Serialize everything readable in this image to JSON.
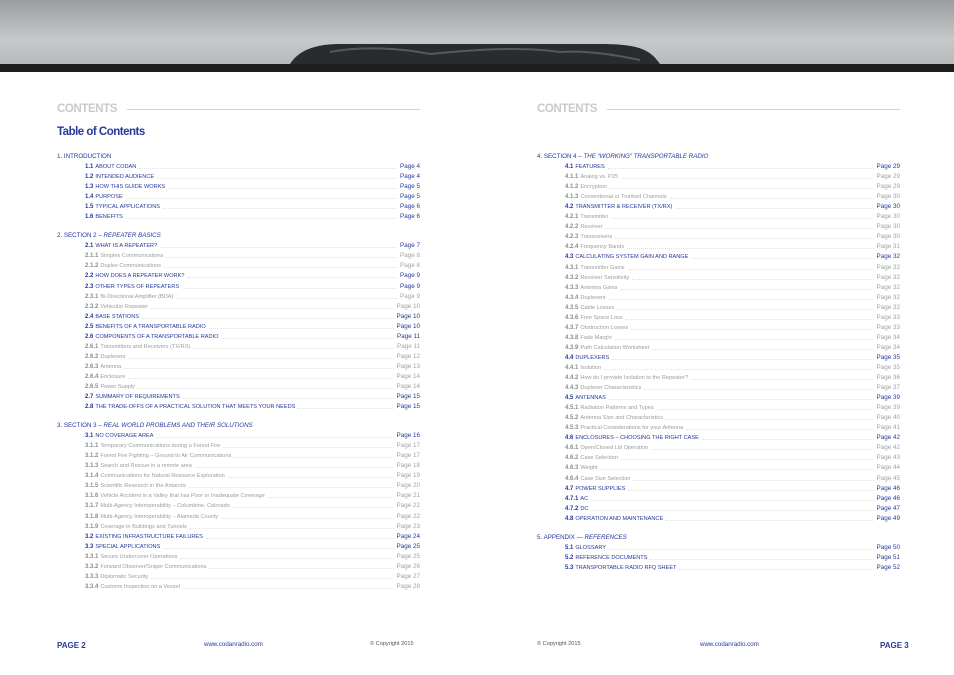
{
  "left": {
    "contents_label": "CONTENTS",
    "title": "Table of Contents",
    "sections": [
      {
        "number": "1.",
        "title": "INTRODUCTION",
        "subtitle": "",
        "entries": [
          {
            "level": 1,
            "num": "1.1",
            "title": "ABOUT CODAN",
            "page": "Page 4"
          },
          {
            "level": 1,
            "num": "1.2",
            "title": "INTENDED AUDIENCE",
            "page": "Page 4"
          },
          {
            "level": 1,
            "num": "1.3",
            "title": "HOW THIS GUIDE WORKS",
            "page": "Page 5"
          },
          {
            "level": 1,
            "num": "1.4",
            "title": "PURPOSE",
            "page": "Page 5"
          },
          {
            "level": 1,
            "num": "1.5",
            "title": "TYPICAL APPLICATIONS",
            "page": "Page 6"
          },
          {
            "level": 1,
            "num": "1.6",
            "title": "BENEFITS",
            "page": "Page 6"
          }
        ]
      },
      {
        "number": "2.",
        "title": "SECTION 2 –",
        "subtitle": "REPEATER BASICS",
        "entries": [
          {
            "level": 1,
            "num": "2.1",
            "title": "WHAT IS A REPEATER?",
            "page": "Page 7"
          },
          {
            "level": 2,
            "num": "2.1.1",
            "title": "Simplex Communications",
            "page": "Page 8"
          },
          {
            "level": 2,
            "num": "2.1.2",
            "title": "Duplex Communications",
            "page": "Page 8"
          },
          {
            "level": 1,
            "num": "2.2",
            "title": "HOW DOES A REPEATER WORK?",
            "page": "Page 9"
          },
          {
            "level": 1,
            "num": "2.3",
            "title": "OTHER TYPES OF REPEATERS",
            "page": "Page 9"
          },
          {
            "level": 2,
            "num": "2.3.1",
            "title": "Bi-Directional Amplifier (BDA)",
            "page": "Page 9"
          },
          {
            "level": 2,
            "num": "2.3.2",
            "title": "Vehicular Repeater",
            "page": "Page 10"
          },
          {
            "level": 1,
            "num": "2.4",
            "title": "BASE STATIONS",
            "page": "Page 10"
          },
          {
            "level": 1,
            "num": "2.5",
            "title": "BENEFITS OF A TRANSPORTABLE RADIO",
            "page": "Page 10"
          },
          {
            "level": 1,
            "num": "2.6",
            "title": "COMPONENTS OF A TRANSPORTABLE RADIO",
            "page": "Page 11"
          },
          {
            "level": 2,
            "num": "2.6.1",
            "title": "Transmitters and Receivers (TX/RX)",
            "page": "Page 11"
          },
          {
            "level": 2,
            "num": "2.6.2",
            "title": "Duplexers",
            "page": "Page 12"
          },
          {
            "level": 2,
            "num": "2.6.3",
            "title": "Antenna",
            "page": "Page 13"
          },
          {
            "level": 2,
            "num": "2.6.4",
            "title": "Enclosure",
            "page": "Page 14"
          },
          {
            "level": 2,
            "num": "2.6.5",
            "title": "Power Supply",
            "page": "Page 14"
          },
          {
            "level": 1,
            "num": "2.7",
            "title": "SUMMARY OF REQUIREMENTS",
            "page": "Page 15"
          },
          {
            "level": 1,
            "num": "2.8",
            "title": "THE TRADE-OFFS OF A PRACTICAL SOLUTION THAT MEETS YOUR NEEDS",
            "page": "Page 15"
          }
        ]
      },
      {
        "number": "3.",
        "title": "SECTION 3 –",
        "subtitle": "REAL WORLD PROBLEMS AND THEIR SOLUTIONS",
        "entries": [
          {
            "level": 1,
            "num": "3.1",
            "title": "NO COVERAGE AREA",
            "page": "Page 16"
          },
          {
            "level": 2,
            "num": "3.1.1",
            "title": "Temporary Communications during a Forest Fire",
            "page": "Page 17"
          },
          {
            "level": 2,
            "num": "3.1.2",
            "title": "Forest Fire Fighting – Ground to Air Communications",
            "page": "Page 17"
          },
          {
            "level": 2,
            "num": "3.1.3",
            "title": "Search and Rescue in a remote area",
            "page": "Page 18"
          },
          {
            "level": 2,
            "num": "3.1.4",
            "title": "Communications for Natural Resource Exploration",
            "page": "Page 19"
          },
          {
            "level": 2,
            "num": "3.1.5",
            "title": "Scientific Research in the Antarctic",
            "page": "Page 20"
          },
          {
            "level": 2,
            "num": "3.1.6",
            "title": "Vehicle Accident in a Valley that has Poor or Inadequate Coverage",
            "page": "Page 21"
          },
          {
            "level": 2,
            "num": "3.1.7",
            "title": "Multi-Agency Interoperability – Columbine, Colorado",
            "page": "Page 22"
          },
          {
            "level": 2,
            "num": "3.1.8",
            "title": "Multi-Agency Interoperability – Alameda County",
            "page": "Page 22"
          },
          {
            "level": 2,
            "num": "3.1.9",
            "title": "Coverage in Buildings and Tunnels",
            "page": "Page 23"
          },
          {
            "level": 1,
            "num": "3.2",
            "title": "EXISTING INFRASTRUCTURE FAILURES",
            "page": "Page 24"
          },
          {
            "level": 1,
            "num": "3.3",
            "title": "SPECIAL APPLICATIONS",
            "page": "Page 25"
          },
          {
            "level": 2,
            "num": "3.3.1",
            "title": "Secure Undercover Operations",
            "page": "Page 25"
          },
          {
            "level": 2,
            "num": "3.3.2",
            "title": "Forward Observer/Sniper Communications",
            "page": "Page 26"
          },
          {
            "level": 2,
            "num": "3.3.3",
            "title": "Diplomatic Security",
            "page": "Page 27"
          },
          {
            "level": 2,
            "num": "3.3.4",
            "title": "Customs Inspection on a Vessel",
            "page": "Page 28"
          }
        ]
      }
    ],
    "footer": {
      "page_label": "PAGE 2",
      "url": "www.codanradio.com",
      "copyright": "© Copyright 2015"
    }
  },
  "right": {
    "contents_label": "CONTENTS",
    "sections": [
      {
        "number": "4.",
        "title": "SECTION 4 –",
        "subtitle": "THE “WORKING” TRANSPORTABLE RADIO",
        "entries": [
          {
            "level": 1,
            "num": "4.1",
            "title": "FEATURES",
            "page": "Page 29"
          },
          {
            "level": 2,
            "num": "4.1.1",
            "title": "Analog vs. P25",
            "page": "Page 29"
          },
          {
            "level": 2,
            "num": "4.1.2",
            "title": "Encryption",
            "page": "Page 29"
          },
          {
            "level": 2,
            "num": "4.1.3",
            "title": "Conventional or Trunked Channels",
            "page": "Page 30"
          },
          {
            "level": 1,
            "num": "4.2",
            "title": "TRANSMITTER & RECEIVER (TX/RX)",
            "page": "Page 30"
          },
          {
            "level": 2,
            "num": "4.2.1",
            "title": "Transmitter",
            "page": "Page 30"
          },
          {
            "level": 2,
            "num": "4.2.2",
            "title": "Receiver",
            "page": "Page 30"
          },
          {
            "level": 2,
            "num": "4.2.3",
            "title": "Transceivers",
            "page": "Page 30"
          },
          {
            "level": 2,
            "num": "4.2.4",
            "title": "Frequency Bands",
            "page": "Page 31"
          },
          {
            "level": 1,
            "num": "4.3",
            "title": "CALCULATING SYSTEM GAIN AND RANGE",
            "page": "Page 32"
          },
          {
            "level": 2,
            "num": "4.3.1",
            "title": "Transmitter Gains",
            "page": "Page 32"
          },
          {
            "level": 2,
            "num": "4.3.2",
            "title": "Receiver Sensitivity",
            "page": "Page 32"
          },
          {
            "level": 2,
            "num": "4.3.3",
            "title": "Antenna Gains",
            "page": "Page 32"
          },
          {
            "level": 2,
            "num": "4.3.4",
            "title": "Duplexers",
            "page": "Page 32"
          },
          {
            "level": 2,
            "num": "4.3.5",
            "title": "Cable Losses",
            "page": "Page 32"
          },
          {
            "level": 2,
            "num": "4.3.6",
            "title": "Free Space Loss",
            "page": "Page 33"
          },
          {
            "level": 2,
            "num": "4.3.7",
            "title": "Obstruction Losses",
            "page": "Page 33"
          },
          {
            "level": 2,
            "num": "4.3.8",
            "title": "Fade Margin",
            "page": "Page 34"
          },
          {
            "level": 2,
            "num": "4.3.9",
            "title": "Path Calculation Worksheet",
            "page": "Page 34"
          },
          {
            "level": 1,
            "num": "4.4",
            "title": "DUPLEXERS",
            "page": "Page 35"
          },
          {
            "level": 2,
            "num": "4.4.1",
            "title": "Isolation",
            "page": "Page 35"
          },
          {
            "level": 2,
            "num": "4.4.2",
            "title": "How do I provide Isolation to the Repeater?",
            "page": "Page 36"
          },
          {
            "level": 2,
            "num": "4.4.3",
            "title": "Duplexer Characteristics",
            "page": "Page 37"
          },
          {
            "level": 1,
            "num": "4.5",
            "title": "ANTENNAS",
            "page": "Page 39"
          },
          {
            "level": 2,
            "num": "4.5.1",
            "title": "Radiation Patterns and Types",
            "page": "Page 39"
          },
          {
            "level": 2,
            "num": "4.5.2",
            "title": "Antenna Size and Characteristics",
            "page": "Page 40"
          },
          {
            "level": 2,
            "num": "4.5.3",
            "title": "Practical Considerations for your Antenna",
            "page": "Page 41"
          },
          {
            "level": 1,
            "num": "4.6",
            "title": "ENCLOSURES – CHOOSING THE RIGHT CASE",
            "page": "Page 42"
          },
          {
            "level": 2,
            "num": "4.6.1",
            "title": "Open/Closed Lid Operation",
            "page": "Page 42"
          },
          {
            "level": 2,
            "num": "4.6.2",
            "title": "Case Selection",
            "page": "Page 43"
          },
          {
            "level": 2,
            "num": "4.6.3",
            "title": "Weight",
            "page": "Page 44"
          },
          {
            "level": 2,
            "num": "4.6.4",
            "title": "Case Size Selection",
            "page": "Page 45"
          },
          {
            "level": 1,
            "num": "4.7",
            "title": "POWER SUPPLIES",
            "page": "Page 46"
          },
          {
            "level": 1,
            "num": "4.7.1",
            "title": "AC",
            "page": "Page 46"
          },
          {
            "level": 1,
            "num": "4.7.2",
            "title": "DC",
            "page": "Page 47"
          },
          {
            "level": 1,
            "num": "4.8",
            "title": "OPERATION AND MAINTENANCE",
            "page": "Page 49"
          }
        ]
      },
      {
        "number": "5.",
        "title": "APPENDIX —",
        "subtitle": "REFERENCES",
        "entries": [
          {
            "level": 1,
            "num": "5.1",
            "title": "GLOSSARY",
            "page": "Page 50"
          },
          {
            "level": 1,
            "num": "5.2",
            "title": "REFERENCE DOCUMENTS",
            "page": "Page 51"
          },
          {
            "level": 1,
            "num": "5.3",
            "title": "TRANSPORTABLE RADIO RFQ SHEET",
            "page": "Page 52"
          }
        ]
      }
    ],
    "footer": {
      "page_label": "PAGE 3",
      "url": "www.codanradio.com",
      "copyright": "© Copyright 2015"
    }
  }
}
